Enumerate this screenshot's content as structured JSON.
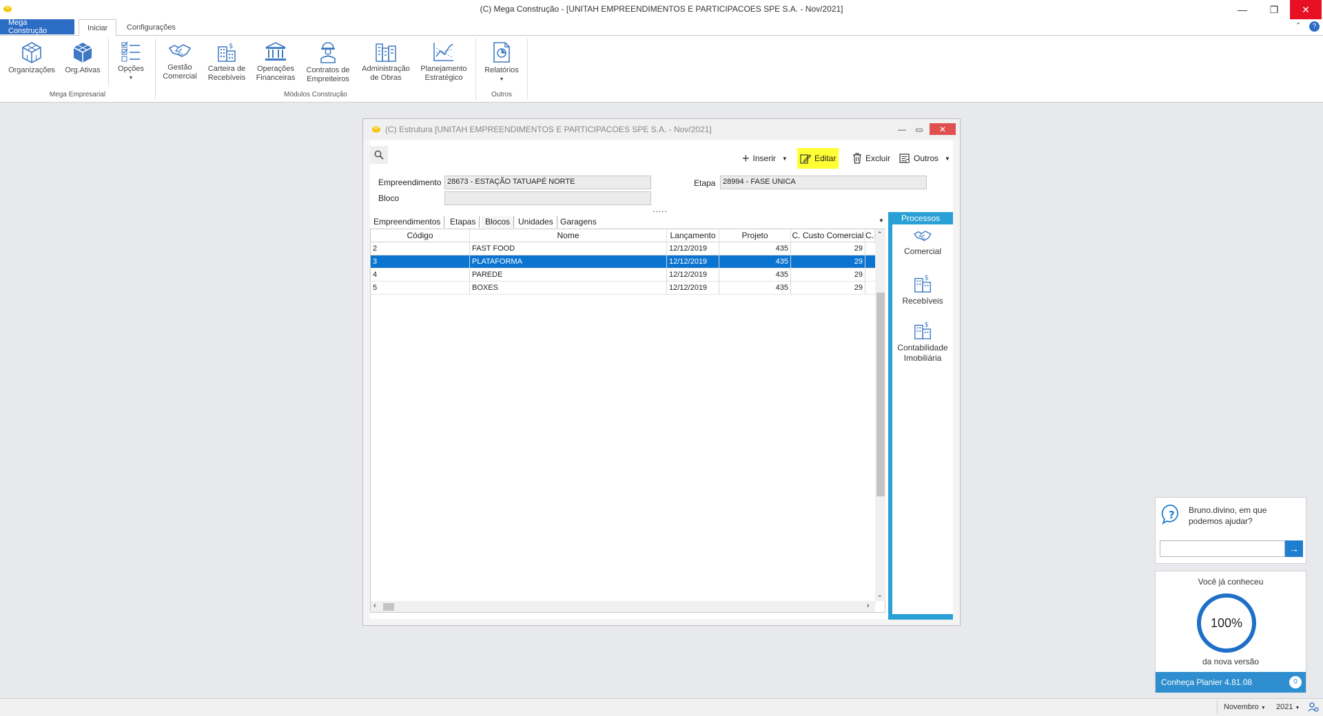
{
  "app": {
    "title": "(C)  Mega Construção - [UNITAH EMPREENDIMENTOS E PARTICIPACOES SPE S.A. - Nov/2021]",
    "window_controls": {
      "minimize": "—",
      "restore": "❐",
      "close": "✕"
    }
  },
  "ribbon": {
    "tabs": [
      "Mega Construção",
      "Iniciar",
      "Configurações"
    ],
    "groups": [
      {
        "label": "Mega Empresarial",
        "buttons": [
          {
            "label": "Organizações",
            "icon": "cube-icon"
          },
          {
            "label": "Org.Ativas",
            "icon": "cube-filled-icon"
          },
          {
            "label": "Opções",
            "icon": "checklist-icon"
          }
        ]
      },
      {
        "label": "Módulos Construção",
        "buttons": [
          {
            "label": "Gestão\nComercial",
            "icon": "handshake-icon"
          },
          {
            "label": "Carteira de\nRecebíveis",
            "icon": "building-dollar-icon"
          },
          {
            "label": "Operações\nFinanceiras",
            "icon": "bank-icon"
          },
          {
            "label": "Contratos de\nEmpreiteiros",
            "icon": "worker-icon"
          },
          {
            "label": "Administração\nde Obras",
            "icon": "buildings-icon"
          },
          {
            "label": "Planejamento\nEstratégico",
            "icon": "chart-icon"
          }
        ]
      },
      {
        "label": "Outros",
        "buttons": [
          {
            "label": "Relatórios",
            "icon": "report-icon"
          }
        ]
      }
    ]
  },
  "window": {
    "title": "(C) Estrutura [UNITAH EMPREENDIMENTOS E PARTICIPACOES SPE S.A. - Nov/2021]",
    "toolbar": {
      "inserir": "Inserir",
      "editar": "Editar",
      "excluir": "Excluir",
      "outros": "Outros"
    },
    "fields": {
      "empreendimento_label": "Empreendimento",
      "empreendimento_value": "28673 - ESTAÇÃO TATUAPÉ NORTE",
      "etapa_label": "Etapa",
      "etapa_value": "28994 - FASE UNICA",
      "bloco_label": "Bloco",
      "bloco_value": ""
    },
    "dots": ".....",
    "tabs": [
      "Empreendimentos",
      "Etapas",
      "Blocos",
      "Unidades",
      "Garagens"
    ],
    "active_tab": "Blocos",
    "grid": {
      "columns": [
        "Código",
        "Nome",
        "Lançamento",
        "Projeto",
        "C. Custo Comercial",
        "C.("
      ],
      "rows": [
        {
          "codigo": "2",
          "nome": "FAST FOOD",
          "lancamento": "12/12/2019",
          "projeto": "435",
          "custo": "29",
          "selected": false
        },
        {
          "codigo": "3",
          "nome": "PLATAFORMA",
          "lancamento": "12/12/2019",
          "projeto": "435",
          "custo": "29",
          "selected": true
        },
        {
          "codigo": "4",
          "nome": "PAREDE",
          "lancamento": "12/12/2019",
          "projeto": "435",
          "custo": "29",
          "selected": false
        },
        {
          "codigo": "5",
          "nome": "BOXES",
          "lancamento": "12/12/2019",
          "projeto": "435",
          "custo": "29",
          "selected": false
        }
      ]
    },
    "processos": {
      "title": "Processos",
      "items": [
        {
          "label": "Comercial",
          "icon": "handshake-icon"
        },
        {
          "label": "Recebíveis",
          "icon": "building-dollar-icon"
        },
        {
          "label": "Contabilidade\nImobiliária",
          "icon": "building-dollar-icon"
        }
      ]
    }
  },
  "help": {
    "text": "Bruno.divino, em que podemos ajudar?",
    "input_value": ""
  },
  "promo": {
    "top": "Você já conheceu",
    "percent": "100%",
    "bottom": "da nova versão",
    "bar": "Conheça Planier 4.81.08",
    "count": "0"
  },
  "status": {
    "month": "Novembro",
    "year": "2021"
  },
  "colors": {
    "accent": "#2b6cc4",
    "selection": "#0a74d0",
    "processos": "#29a1d6",
    "editar_highlight": "#ffff33",
    "close": "#e81123"
  }
}
